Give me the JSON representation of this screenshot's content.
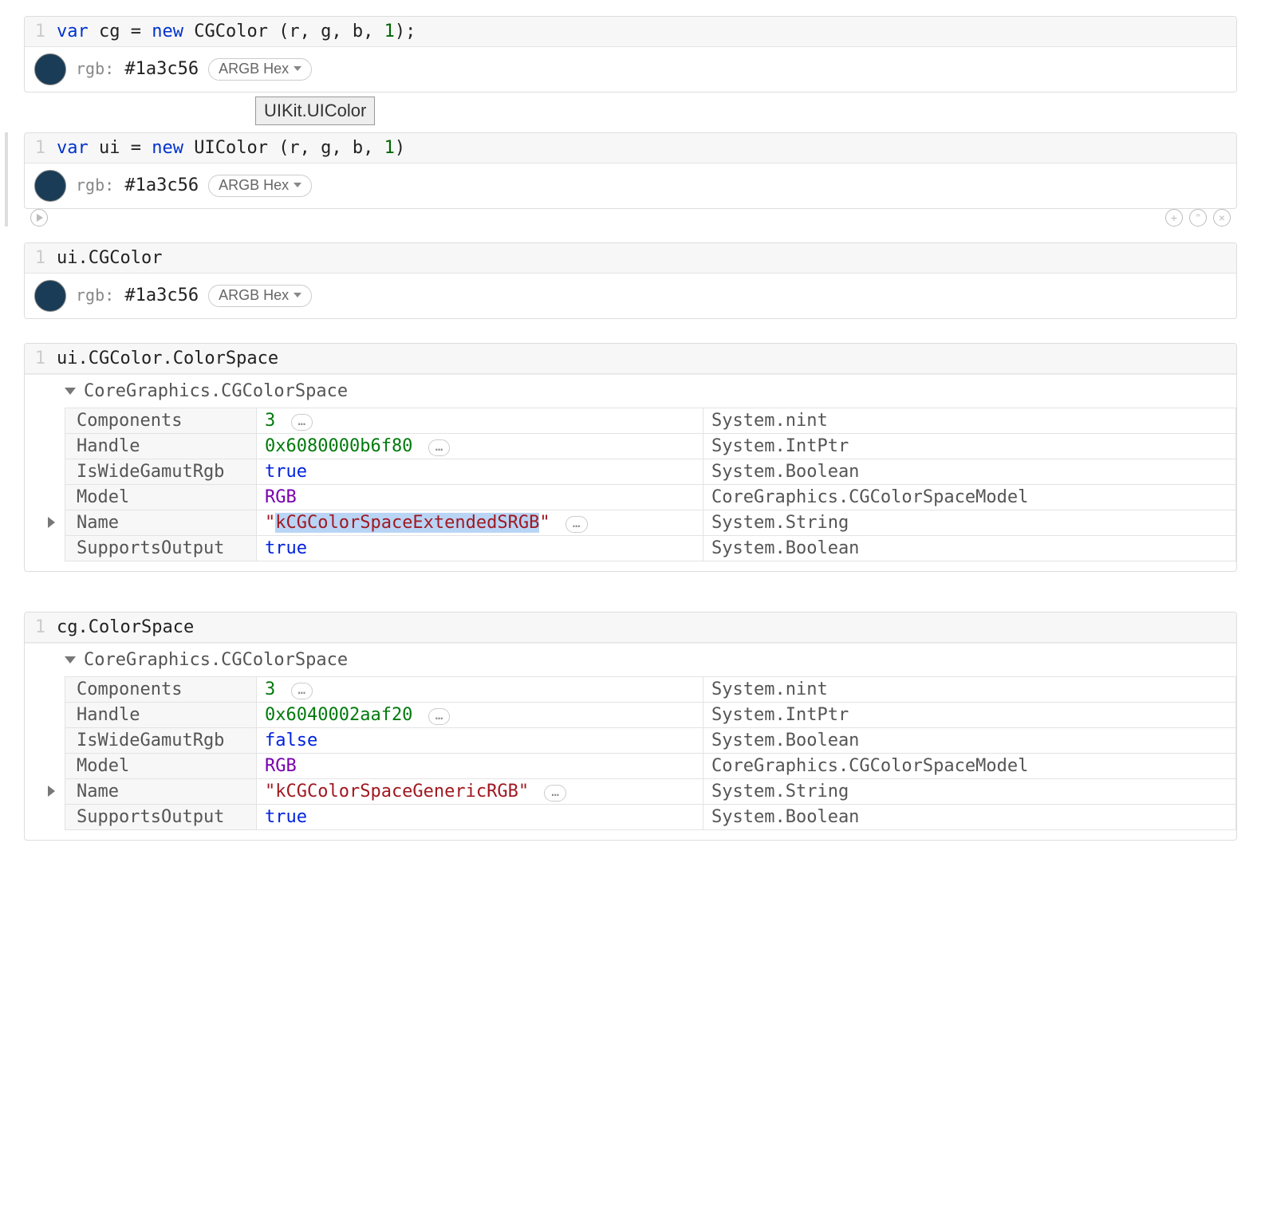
{
  "cell1": {
    "lineNum": "1",
    "codeParts": {
      "var": "var",
      "cg": " cg ",
      "eq": "= ",
      "new": "new",
      "ctor": " CGColor (r, g, b, ",
      "one": "1",
      "end": ");"
    },
    "swatchColor": "#1a3c56",
    "rgbLabel": "rgb:",
    "hexValue": "#1a3c56",
    "pillLabel": "ARGB Hex"
  },
  "tooltip": "UIKit.UIColor",
  "cell2": {
    "lineNum": "1",
    "codeParts": {
      "var": "var",
      "ui": " ui ",
      "eq": "= ",
      "new": "new",
      "ctor": " UIColor (r, g, b, ",
      "one": "1",
      "end": ")"
    },
    "swatchColor": "#1a3c56",
    "rgbLabel": "rgb:",
    "hexValue": "#1a3c56",
    "pillLabel": "ARGB Hex"
  },
  "gutter": {
    "plus": "+",
    "quote": "”",
    "x": "×"
  },
  "cell3": {
    "lineNum": "1",
    "code": "ui.CGColor",
    "swatchColor": "#1a3c56",
    "rgbLabel": "rgb:",
    "hexValue": "#1a3c56",
    "pillLabel": "ARGB Hex"
  },
  "cell4": {
    "lineNum": "1",
    "code": "ui.CGColor.ColorSpace",
    "typeName": "CoreGraphics.CGColorSpace",
    "ellipsis": "…",
    "rows": [
      {
        "prop": "Components",
        "val": "3",
        "valClass": "v-green",
        "ell": true,
        "type": "System.nint"
      },
      {
        "prop": "Handle",
        "val": "0x6080000b6f80",
        "valClass": "v-green",
        "ell": true,
        "type": "System.IntPtr"
      },
      {
        "prop": "IsWideGamutRgb",
        "val": "true",
        "valClass": "v-blue",
        "ell": false,
        "type": "System.Boolean"
      },
      {
        "prop": "Model",
        "val": "RGB",
        "valClass": "v-purple",
        "ell": false,
        "type": "CoreGraphics.CGColorSpaceModel"
      },
      {
        "prop": "Name",
        "val": "\"kCGColorSpaceExtendedSRGB\"",
        "valClass": "v-red",
        "ell": true,
        "highlight": true,
        "expandable": true,
        "type": "System.String"
      },
      {
        "prop": "SupportsOutput",
        "val": "true",
        "valClass": "v-blue",
        "ell": false,
        "type": "System.Boolean"
      }
    ]
  },
  "cell5": {
    "lineNum": "1",
    "code": "cg.ColorSpace",
    "typeName": "CoreGraphics.CGColorSpace",
    "ellipsis": "…",
    "rows": [
      {
        "prop": "Components",
        "val": "3",
        "valClass": "v-green",
        "ell": true,
        "type": "System.nint"
      },
      {
        "prop": "Handle",
        "val": "0x6040002aaf20",
        "valClass": "v-green",
        "ell": true,
        "type": "System.IntPtr"
      },
      {
        "prop": "IsWideGamutRgb",
        "val": "false",
        "valClass": "v-blue",
        "ell": false,
        "type": "System.Boolean"
      },
      {
        "prop": "Model",
        "val": "RGB",
        "valClass": "v-purple",
        "ell": false,
        "type": "CoreGraphics.CGColorSpaceModel"
      },
      {
        "prop": "Name",
        "val": "\"kCGColorSpaceGenericRGB\"",
        "valClass": "v-red",
        "ell": true,
        "highlight": false,
        "expandable": true,
        "type": "System.String"
      },
      {
        "prop": "SupportsOutput",
        "val": "true",
        "valClass": "v-blue",
        "ell": false,
        "type": "System.Boolean"
      }
    ]
  }
}
